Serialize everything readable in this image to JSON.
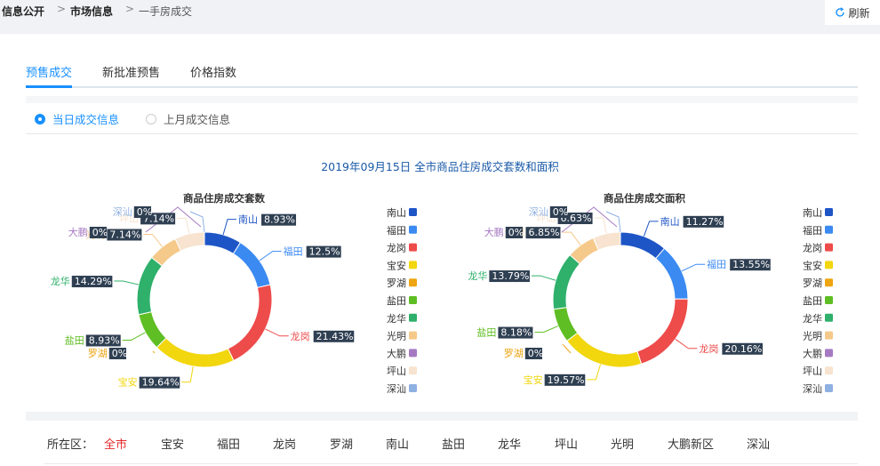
{
  "breadcrumb": {
    "item1": "信息公开",
    "item2": "市场信息",
    "item3": "一手房成交",
    "sep": ">"
  },
  "refresh": {
    "label": "刷新",
    "icon": "refresh-icon"
  },
  "tabs": [
    "预售成交",
    "新批准预售",
    "价格指数"
  ],
  "radios": {
    "today": "当日成交信息",
    "lastmonth": "上月成交信息"
  },
  "main_title": "2019年09月15日 全市商品住房成交套数和面积",
  "legend": [
    "南山",
    "福田",
    "龙岗",
    "宝安",
    "罗湖",
    "盐田",
    "龙华",
    "光明",
    "大鹏",
    "坪山",
    "深汕"
  ],
  "colors": {
    "南山": "#1e55c6",
    "福田": "#3b8af2",
    "龙岗": "#ee4b4b",
    "宝安": "#f2d60e",
    "罗湖": "#eea511",
    "盐田": "#5fbe23",
    "龙华": "#2fb06b",
    "光明": "#f5c98a",
    "大鹏": "#a579c2",
    "坪山": "#f7e3cf",
    "深汕": "#8fb1e2"
  },
  "chart_data": [
    {
      "type": "pie",
      "title": "商品住房成交套数",
      "categories": [
        "南山",
        "福田",
        "龙岗",
        "宝安",
        "罗湖",
        "盐田",
        "龙华",
        "光明",
        "大鹏",
        "坪山",
        "深汕"
      ],
      "values": [
        8.93,
        12.5,
        21.43,
        19.64,
        0,
        8.93,
        14.29,
        7.14,
        0,
        7.14,
        0
      ],
      "labels": [
        "8.93%",
        "12.5%",
        "21.43%",
        "19.64%",
        "0%",
        "8.93%",
        "14.29%",
        "7.14%",
        "0%",
        "7.14%",
        "0%"
      ],
      "legend_position": "right"
    },
    {
      "type": "pie",
      "title": "商品住房成交面积",
      "categories": [
        "南山",
        "福田",
        "龙岗",
        "宝安",
        "罗湖",
        "盐田",
        "龙华",
        "光明",
        "大鹏",
        "坪山",
        "深汕"
      ],
      "values": [
        11.27,
        13.55,
        20.16,
        19.57,
        0,
        8.18,
        13.79,
        6.85,
        0,
        6.63,
        0
      ],
      "labels": [
        "11.27%",
        "13.55%",
        "20.16%",
        "19.57%",
        "0%",
        "8.18%",
        "13.79%",
        "6.85%",
        "0%",
        "6.63%",
        "0%"
      ],
      "legend_position": "right"
    }
  ],
  "district_filter": {
    "label": "所在区：",
    "items": [
      "全市",
      "宝安",
      "福田",
      "龙岗",
      "罗湖",
      "南山",
      "盐田",
      "龙华",
      "坪山",
      "光明",
      "大鹏新区",
      "深汕"
    ]
  }
}
